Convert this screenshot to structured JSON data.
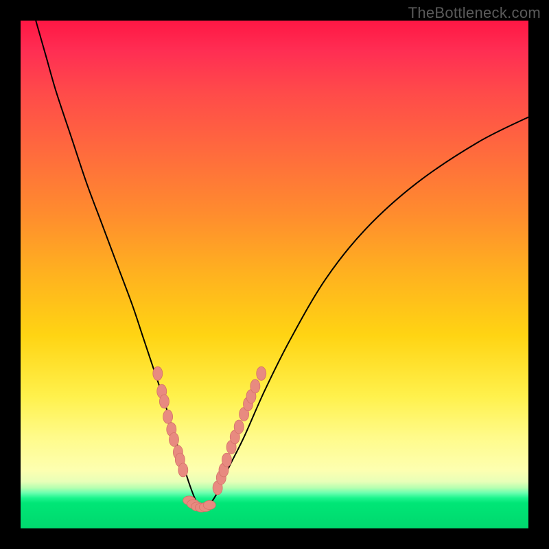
{
  "watermark": "TheBottleneck.com",
  "colors": {
    "axis_bg": "#000000",
    "curve_stroke": "#000000",
    "marker_fill": "#e88a80",
    "marker_stroke": "#d47168"
  },
  "chart_data": {
    "type": "line",
    "title": "",
    "xlabel": "",
    "ylabel": "",
    "xlim": [
      0,
      100
    ],
    "ylim": [
      0,
      100
    ],
    "grid": false,
    "legend": false,
    "series": [
      {
        "name": "bottleneck-curve",
        "x": [
          3,
          5,
          7,
          10,
          13,
          16,
          19,
          22,
          24,
          26,
          28,
          29.5,
          31,
          32.5,
          33.5,
          34.5,
          35.5,
          37,
          39,
          41,
          44,
          48,
          53,
          60,
          68,
          78,
          90,
          100
        ],
        "y": [
          100,
          93,
          86,
          77,
          68,
          60,
          52,
          44,
          38,
          32,
          26,
          21,
          16,
          11,
          8,
          5.5,
          4,
          4.5,
          7.5,
          12,
          18,
          27,
          37,
          49,
          59,
          68,
          76,
          81
        ]
      }
    ],
    "markers": {
      "left_cluster": [
        {
          "x": 27.0,
          "y": 30.5
        },
        {
          "x": 27.8,
          "y": 27.0
        },
        {
          "x": 28.3,
          "y": 25.0
        },
        {
          "x": 29.0,
          "y": 22.0
        },
        {
          "x": 29.7,
          "y": 19.5
        },
        {
          "x": 30.2,
          "y": 17.5
        },
        {
          "x": 31.0,
          "y": 15.0
        },
        {
          "x": 31.4,
          "y": 13.5
        },
        {
          "x": 32.0,
          "y": 11.5
        }
      ],
      "bottom_cluster": [
        {
          "x": 33.2,
          "y": 5.5
        },
        {
          "x": 34.0,
          "y": 4.8
        },
        {
          "x": 34.8,
          "y": 4.3
        },
        {
          "x": 35.6,
          "y": 4.1
        },
        {
          "x": 36.4,
          "y": 4.2
        },
        {
          "x": 37.2,
          "y": 4.6
        }
      ],
      "right_cluster": [
        {
          "x": 38.8,
          "y": 8.0
        },
        {
          "x": 39.5,
          "y": 10.0
        },
        {
          "x": 40.0,
          "y": 11.5
        },
        {
          "x": 40.6,
          "y": 13.5
        },
        {
          "x": 41.5,
          "y": 16.0
        },
        {
          "x": 42.2,
          "y": 18.0
        },
        {
          "x": 43.0,
          "y": 20.0
        },
        {
          "x": 44.0,
          "y": 22.5
        },
        {
          "x": 44.8,
          "y": 24.5
        },
        {
          "x": 45.4,
          "y": 26.0
        },
        {
          "x": 46.2,
          "y": 28.0
        },
        {
          "x": 47.4,
          "y": 30.5
        }
      ]
    }
  }
}
